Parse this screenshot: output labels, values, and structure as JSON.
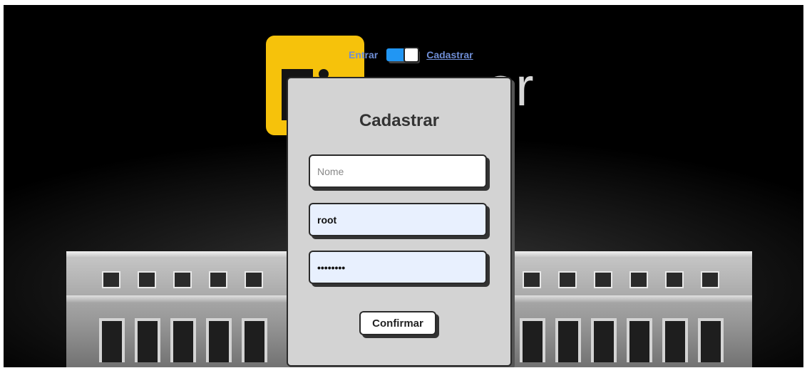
{
  "nav": {
    "login_label": "Entrar",
    "signup_label": "Cadastrar",
    "toggle_on": true,
    "toggle_color": "#2196f3"
  },
  "form": {
    "title": "Cadastrar",
    "name_placeholder": "Nome",
    "name_value": "",
    "user_value": "root",
    "password_value": "••••••••",
    "submit_label": "Confirmar"
  },
  "colors": {
    "card_bg": "#d3d3d3",
    "logo_yellow": "#f6c20b",
    "autofill_bg": "#e8f0fe"
  }
}
